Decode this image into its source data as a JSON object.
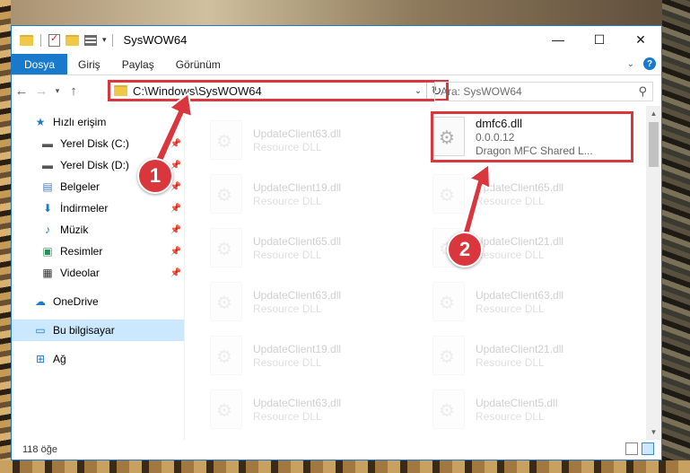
{
  "window": {
    "title": "SysWOW64",
    "caption": {
      "minimize": "—",
      "maximize": "☐",
      "close": "✕"
    }
  },
  "ribbon": {
    "tabs": [
      "Dosya",
      "Giriş",
      "Paylaş",
      "Görünüm"
    ]
  },
  "address": {
    "path": "C:\\Windows\\SysWOW64",
    "search_placeholder": "Ara: SysWOW64"
  },
  "sidebar": {
    "quick_access": "Hızlı erişim",
    "items": [
      {
        "label": "Yerel Disk (C:)",
        "icon": "drive-icon"
      },
      {
        "label": "Yerel Disk (D:)",
        "icon": "drive-icon"
      },
      {
        "label": "Belgeler",
        "icon": "documents-icon"
      },
      {
        "label": "İndirmeler",
        "icon": "download-icon"
      },
      {
        "label": "Müzik",
        "icon": "music-icon"
      },
      {
        "label": "Resimler",
        "icon": "pictures-icon"
      },
      {
        "label": "Videolar",
        "icon": "video-icon"
      }
    ],
    "onedrive": "OneDrive",
    "this_pc": "Bu bilgisayar",
    "network": "Ağ"
  },
  "files": {
    "target": {
      "name": "dmfc6.dll",
      "version": "0.0.0.12",
      "description": "Dragon MFC Shared L..."
    },
    "col1": [
      {
        "name": "UpdateClient63.dll",
        "sub": "Resource DLL"
      },
      {
        "name": "UpdateClient19.dll",
        "sub": "Resource DLL"
      },
      {
        "name": "UpdateClient65.dll",
        "sub": "Resource DLL"
      },
      {
        "name": "UpdateClient63.dll",
        "sub": "Resource DLL"
      },
      {
        "name": "UpdateClient19.dll",
        "sub": "Resource DLL"
      },
      {
        "name": "UpdateClient63.dll",
        "sub": "Resource DLL"
      }
    ],
    "col2": [
      {
        "name": "UpdateClient65.dll",
        "sub": "Resource DLL"
      },
      {
        "name": "UpdateClient21.dll",
        "sub": "Resource DLL"
      },
      {
        "name": "UpdateClient63.dll",
        "sub": "Resource DLL"
      },
      {
        "name": "UpdateClient21.dll",
        "sub": "Resource DLL"
      },
      {
        "name": "UpdateClient5.dll",
        "sub": "Resource DLL"
      }
    ]
  },
  "status": {
    "count": "118 öğe"
  },
  "callouts": {
    "one": "1",
    "two": "2"
  },
  "colors": {
    "accent": "#1979ca",
    "highlight": "#d9363e",
    "selected": "#cce8ff"
  }
}
